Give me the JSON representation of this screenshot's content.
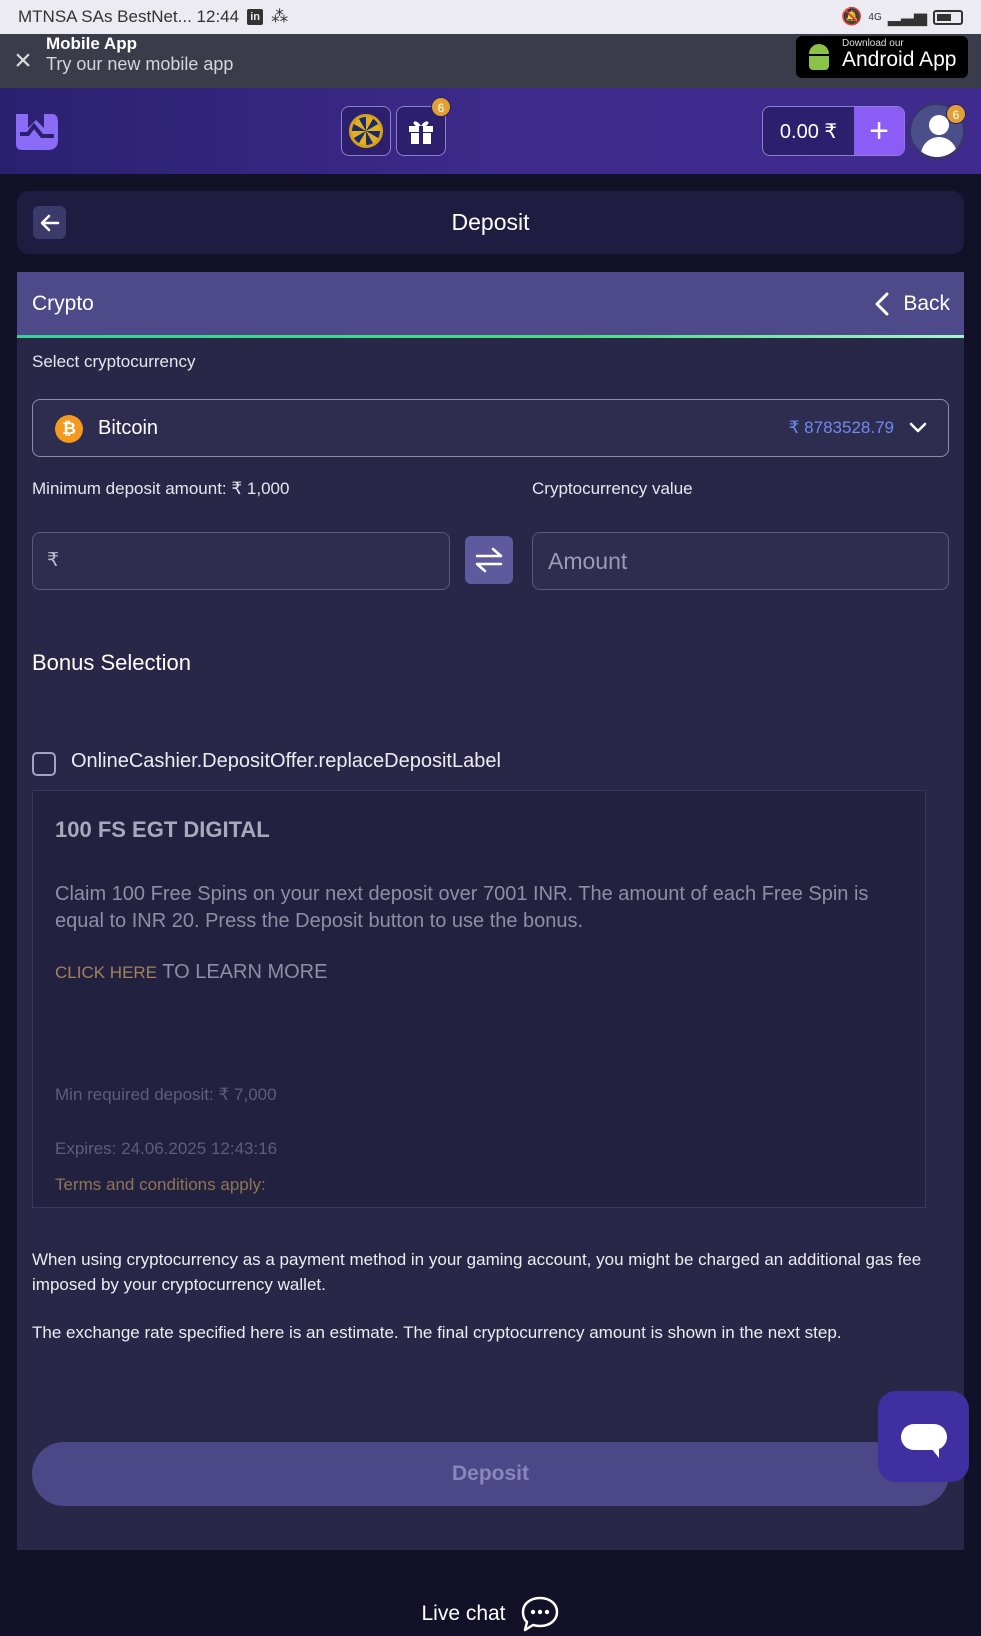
{
  "status_bar": {
    "carrier_time": "MTNSA SAs BestNet...  12:44",
    "linkedin": "in",
    "network": "4G"
  },
  "app_banner": {
    "title": "Mobile App",
    "subtitle": "Try our new mobile app",
    "download_small": "Download our",
    "download_big": "Android App"
  },
  "header": {
    "gift_badge": "6",
    "balance": "0.00 ₹",
    "plus": "+",
    "profile_badge": "6",
    "accent_color": "#8b5cf6"
  },
  "page": {
    "title": "Deposit"
  },
  "method_bar": {
    "label": "Crypto",
    "back_label": "Back"
  },
  "form": {
    "select_label": "Select cryptocurrency",
    "coin_symbol": "₿",
    "coin_name": "Bitcoin",
    "coin_rate": "₹ 8783528.79",
    "min_deposit_label": "Minimum deposit amount: ₹ 1,000",
    "fiat_currency": "₹",
    "crypto_value_label": "Cryptocurrency value",
    "crypto_placeholder": "Amount"
  },
  "bonus": {
    "heading": "Bonus Selection",
    "checkbox_label": "OnlineCashier.DepositOffer.replaceDepositLabel",
    "offer_title": "100 FS EGT DIGITAL",
    "offer_desc": "Claim 100 Free Spins on your next deposit over 7001 INR. The amount of each Free Spin is equal to INR 20. Press the Deposit button to use the bonus.",
    "click_here": "CLICK HERE",
    "learn_more": " TO LEARN MORE",
    "min_required": "Min required deposit: ₹ 7,000",
    "expires": "Expires: 24.06.2025 12:43:16",
    "terms": "Terms and conditions apply:"
  },
  "notes": {
    "gas_fee": "When using cryptocurrency as a payment method in your gaming account, you might be charged an additional gas fee imposed by your cryptocurrency wallet.",
    "exchange_rate": "The exchange rate specified here is an estimate. The final cryptocurrency amount is shown in the next step."
  },
  "actions": {
    "deposit_button": "Deposit",
    "live_chat": "Live chat"
  }
}
